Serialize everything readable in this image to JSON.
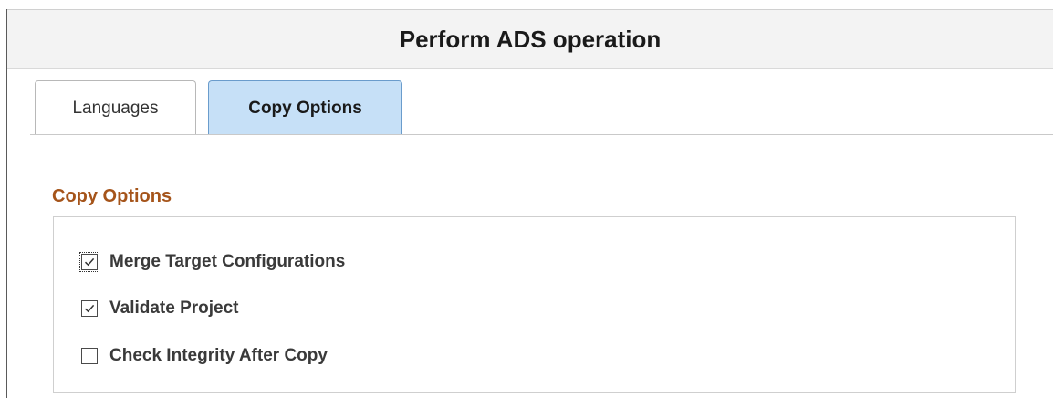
{
  "page": {
    "title": "Perform ADS operation"
  },
  "tabs": [
    {
      "label": "Languages",
      "active": false
    },
    {
      "label": "Copy Options",
      "active": true
    }
  ],
  "copy_options": {
    "heading": "Copy Options",
    "options": [
      {
        "label": "Merge Target Configurations",
        "checked": true,
        "focused": true
      },
      {
        "label": "Validate Project",
        "checked": true,
        "focused": false
      },
      {
        "label": "Check Integrity After Copy",
        "checked": false,
        "focused": false
      }
    ]
  },
  "colors": {
    "accent_heading": "#a5541a",
    "active_tab": "#c6e0f7"
  }
}
